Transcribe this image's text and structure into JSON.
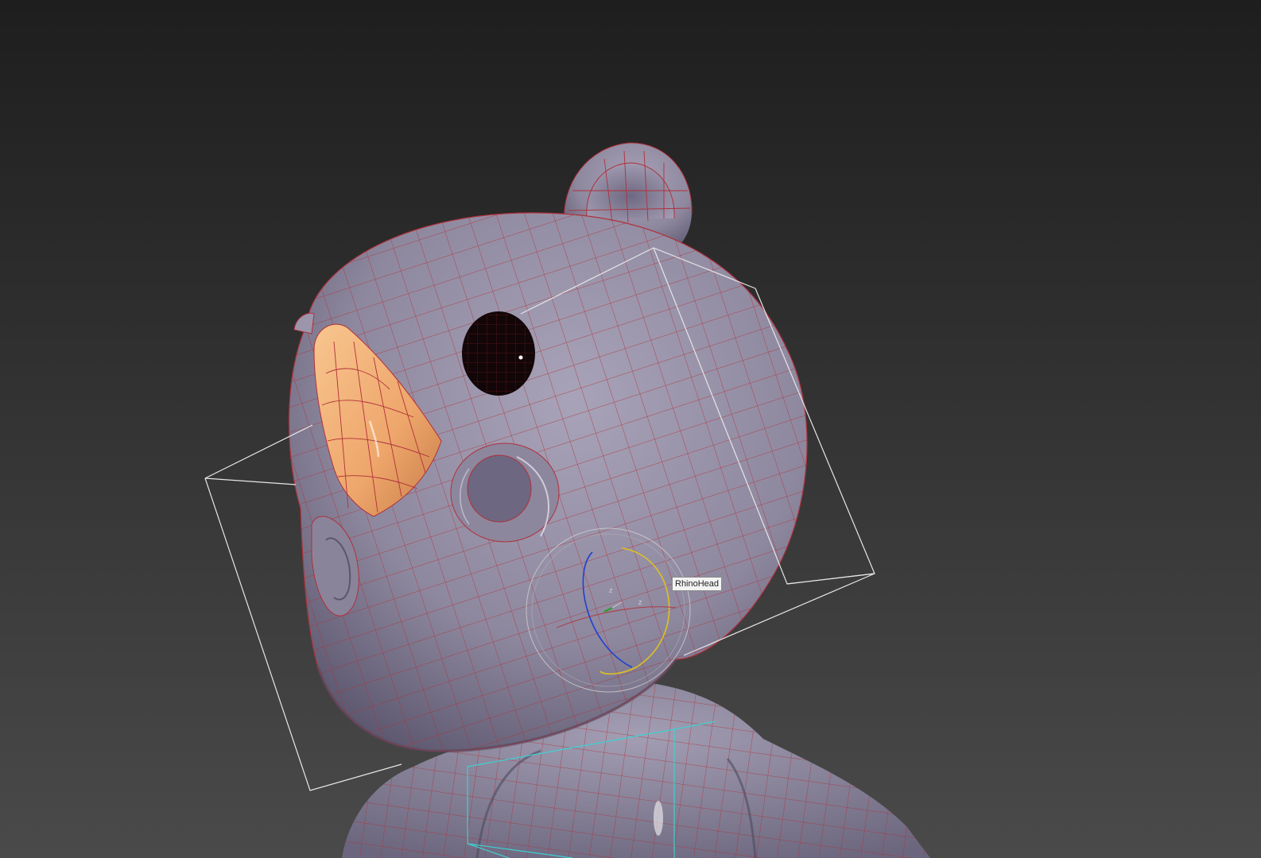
{
  "viewport": {
    "selected_object": "RhinoHead",
    "background_top": "#1f1f1f",
    "background_bottom": "#4a4a4a"
  },
  "colors": {
    "body": "#9c97ab",
    "body_shadow": "#57536a",
    "wire": "#b0303a",
    "horn": "#f0b27a",
    "horn_shadow": "#c47a45",
    "eye": "#120608",
    "bbox_selected": "#e8e8e8",
    "bbox_child": "#3fd0d0",
    "gizmo_x": "#e0c020",
    "gizmo_y": "#2040d0",
    "gizmo_z": "#20a020"
  },
  "gizmo": {
    "labels": [
      "z",
      "z"
    ]
  }
}
